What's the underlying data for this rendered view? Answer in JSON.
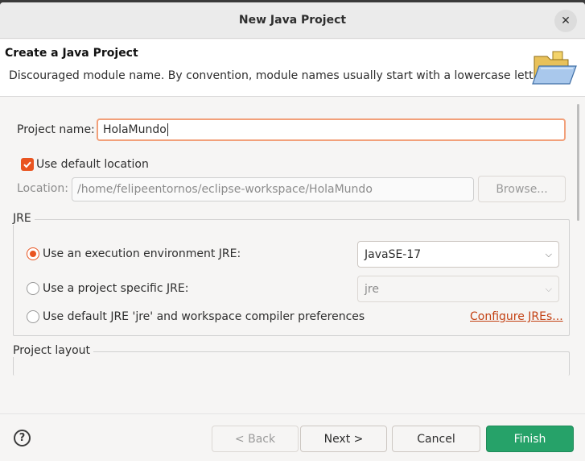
{
  "window": {
    "title": "New Java Project"
  },
  "banner": {
    "heading": "Create a Java Project",
    "message": "Discouraged module name. By convention, module names usually start with a lowercase letter"
  },
  "form": {
    "project_name_label": "Project name:",
    "project_name_value": "HolaMundo",
    "use_default_location_label": "Use default location",
    "use_default_location_checked": true,
    "location_label": "Location:",
    "location_value": "/home/felipeentornos/eclipse-workspace/HolaMundo",
    "browse_label": "Browse..."
  },
  "jre": {
    "group_title": "JRE",
    "option_execution_env": "Use an execution environment JRE:",
    "option_project_specific": "Use a project specific JRE:",
    "option_default": "Use default JRE 'jre' and workspace compiler preferences",
    "selected_option": "execution_env",
    "execution_env_value": "JavaSE-17",
    "project_specific_value": "jre",
    "configure_link": "Configure JREs..."
  },
  "project_layout": {
    "group_title": "Project layout"
  },
  "footer": {
    "back_label": "< Back",
    "next_label": "Next >",
    "cancel_label": "Cancel",
    "finish_label": "Finish"
  },
  "colors": {
    "accent": "#e95420",
    "finish": "#26a269",
    "link": "#c34113"
  },
  "icons": {
    "close": "close-icon",
    "banner": "folder-icon",
    "help": "help-icon",
    "combo": "chevron-down-icon",
    "checkbox": "checkmark-icon"
  }
}
